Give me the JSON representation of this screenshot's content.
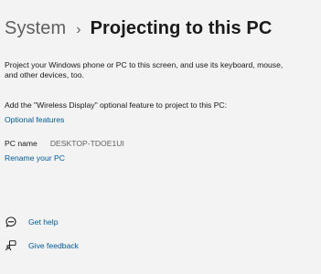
{
  "breadcrumb": {
    "parent": "System",
    "separator": "›",
    "current": "Projecting to this PC"
  },
  "description": "Project your Windows phone or PC to this screen, and use its keyboard, mouse, and other devices, too.",
  "wireless_display_text": "Add the \"Wireless Display\" optional feature to project to this PC:",
  "optional_features_link": "Optional features",
  "pc_name": {
    "label": "PC name",
    "value": "DESKTOP-TDOE1UI"
  },
  "rename_link": "Rename your PC",
  "help": {
    "get_help": "Get help",
    "give_feedback": "Give feedback"
  },
  "icons": {
    "get_help": "get-help-icon",
    "give_feedback": "feedback-icon"
  },
  "colors": {
    "background": "#f3f3f3",
    "link": "#005a9e",
    "text": "#1a1a1a",
    "muted": "#5f5f5f"
  }
}
